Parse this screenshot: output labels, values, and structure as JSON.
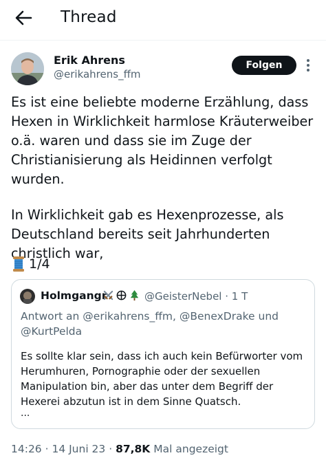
{
  "header": {
    "title": "Thread",
    "back_icon": "arrow-left-icon"
  },
  "tweet": {
    "author_name": "Erik Ahrens",
    "author_handle": "@erikahrens_ffm",
    "follow_label": "Folgen",
    "paragraph1": "Es ist eine beliebte moderne Erzählung, dass Hexen in Wirklichkeit harmlose Kräuterweiber o.ä. waren und dass sie im Zuge der Christianisierung als Heidinnen verfolgt wurden.",
    "paragraph2": "In Wirklichkeit gab es Hexenprozesse, als Deutschland bereits seit Jahrhunderten christlich war,",
    "thread_icon": "thread-spool-icon",
    "thread_count": "1/4"
  },
  "quote": {
    "name": "Holmgangr",
    "emojis": [
      "crossed-swords-icon",
      "circle-cross-icon",
      "evergreen-tree-icon"
    ],
    "handle": "@GeisterNebel",
    "time": "1 T",
    "reply_to": "Antwort an @erikahrens_ffm, @BenexDrake und @KurtPelda",
    "text": "Es sollte klar sein, dass ich auch kein Befürworter vom Herumhuren, Pornographie oder der sexuellen Manipulation bin, aber das unter dem Begriff der Hexerei abzutun ist in dem Sinne Quatsch.",
    "ellipsis": "..."
  },
  "meta": {
    "time": "14:26",
    "date": "14 Juni 23",
    "views_count": "87,8K",
    "views_label": "Mal angezeigt"
  }
}
